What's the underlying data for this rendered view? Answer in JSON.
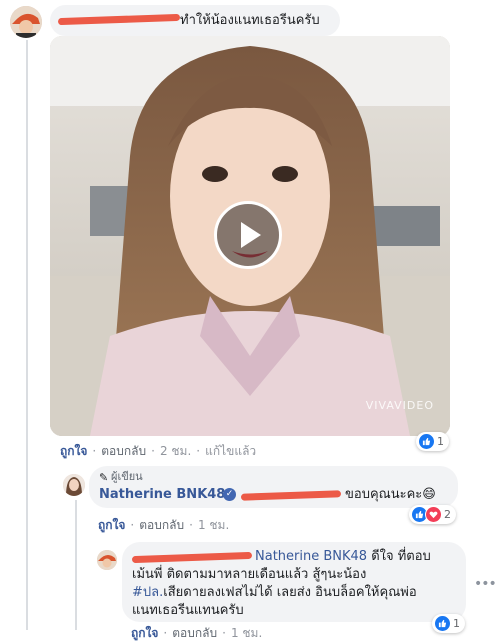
{
  "comment1": {
    "text": "ทำให้น้องแนทเธอรีนครับ",
    "actions": {
      "like": "ถูกใจ",
      "reply": "ตอบกลับ",
      "time": "2 ชม.",
      "edited": "แก้ไขแล้ว"
    },
    "reactions": {
      "count": "1"
    },
    "video": {
      "watermark": "VIVAVIDEO",
      "play_icon": "play-icon"
    }
  },
  "reply1": {
    "author_badge": "ผู้เขียน",
    "author_name": "Natherine BNK48",
    "text": "ขอบคุณนะคะ",
    "emoji": "😄",
    "actions": {
      "like": "ถูกใจ",
      "reply": "ตอบกลับ",
      "time": "1 ชม."
    },
    "reactions": {
      "count": "2"
    }
  },
  "reply2": {
    "mention": "Natherine BNK48",
    "text_line1": "ดีใจ ที่ตอบ",
    "text_line2": "เม้นพี่ ติดตามมาหลายเดือนแล้ว สู้ๆนะน้อง",
    "hashtag": "#ปล.",
    "text_line3": "เสียดายลงเฟสไม่ได้ เลยส่ง อินบล็อคให้คุณพ่อ",
    "text_line4": "แนทเธอรีนแทนครับ",
    "more_icon": "ellipsis-icon",
    "actions": {
      "like": "ถูกใจ",
      "reply": "ตอบกลับ",
      "time": "1 ชม."
    },
    "reactions": {
      "count": "1"
    }
  },
  "colors": {
    "link": "#385898",
    "bubble": "#f2f3f5",
    "redaction": "#ec5a47",
    "like": "#1877f2",
    "love": "#f33e58"
  }
}
